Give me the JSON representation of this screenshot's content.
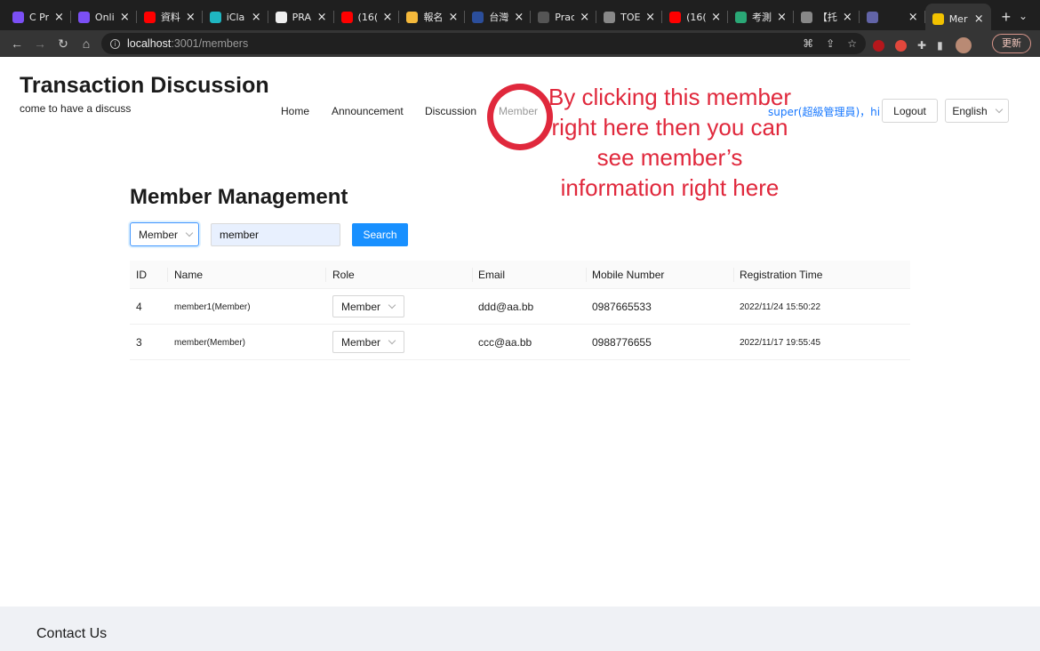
{
  "browser": {
    "tabs": [
      {
        "title": "C Pr",
        "color": "#7b4ff5"
      },
      {
        "title": "Onli",
        "color": "#7b4ff5"
      },
      {
        "title": "資料",
        "color": "#ff0000"
      },
      {
        "title": "iCla",
        "color": "#1fb6c1"
      },
      {
        "title": "PRA",
        "color": "#eeeeee"
      },
      {
        "title": "(16(",
        "color": "#ff0000"
      },
      {
        "title": "報名",
        "color": "#f5b93b"
      },
      {
        "title": "台灣",
        "color": "#2b4e9b"
      },
      {
        "title": "Prac",
        "color": "#555555"
      },
      {
        "title": "TOE",
        "color": "#888888"
      },
      {
        "title": "(16(",
        "color": "#ff0000"
      },
      {
        "title": "考測",
        "color": "#2aa876"
      },
      {
        "title": "【托",
        "color": "#888888"
      },
      {
        "title": "",
        "color": "#6264a7"
      },
      {
        "title": "Mer",
        "color": "#f2c200",
        "active": true
      }
    ],
    "new_tab": "+",
    "url_host": "localhost",
    "url_path": ":3001/members",
    "update_label": "更新"
  },
  "header": {
    "brand_title": "Transaction Discussion",
    "brand_subtitle": "come to have a discuss",
    "nav": {
      "home": "Home",
      "announcement": "Announcement",
      "discussion": "Discussion",
      "member": "Member"
    },
    "user_link": "super(超級管理員)，hi",
    "logout": "Logout",
    "language": "English"
  },
  "annotation": {
    "text": "By clicking this member right here then you can see member’s information right here",
    "color": "#e0283c"
  },
  "main": {
    "heading": "Member Management",
    "filter_type": "Member",
    "search_value": "member",
    "search_button": "Search",
    "table": {
      "columns": [
        "ID",
        "Name",
        "Role",
        "Email",
        "Mobile Number",
        "Registration Time"
      ],
      "rows": [
        {
          "id": "4",
          "name": "member1(Member)",
          "role": "Member",
          "email": "ddd@aa.bb",
          "mobile": "0987665533",
          "registered": "2022/11/24 15:50:22"
        },
        {
          "id": "3",
          "name": "member(Member)",
          "role": "Member",
          "email": "ccc@aa.bb",
          "mobile": "0988776655",
          "registered": "2022/11/17 19:55:45"
        }
      ]
    }
  },
  "footer": {
    "title": "Contact Us"
  }
}
